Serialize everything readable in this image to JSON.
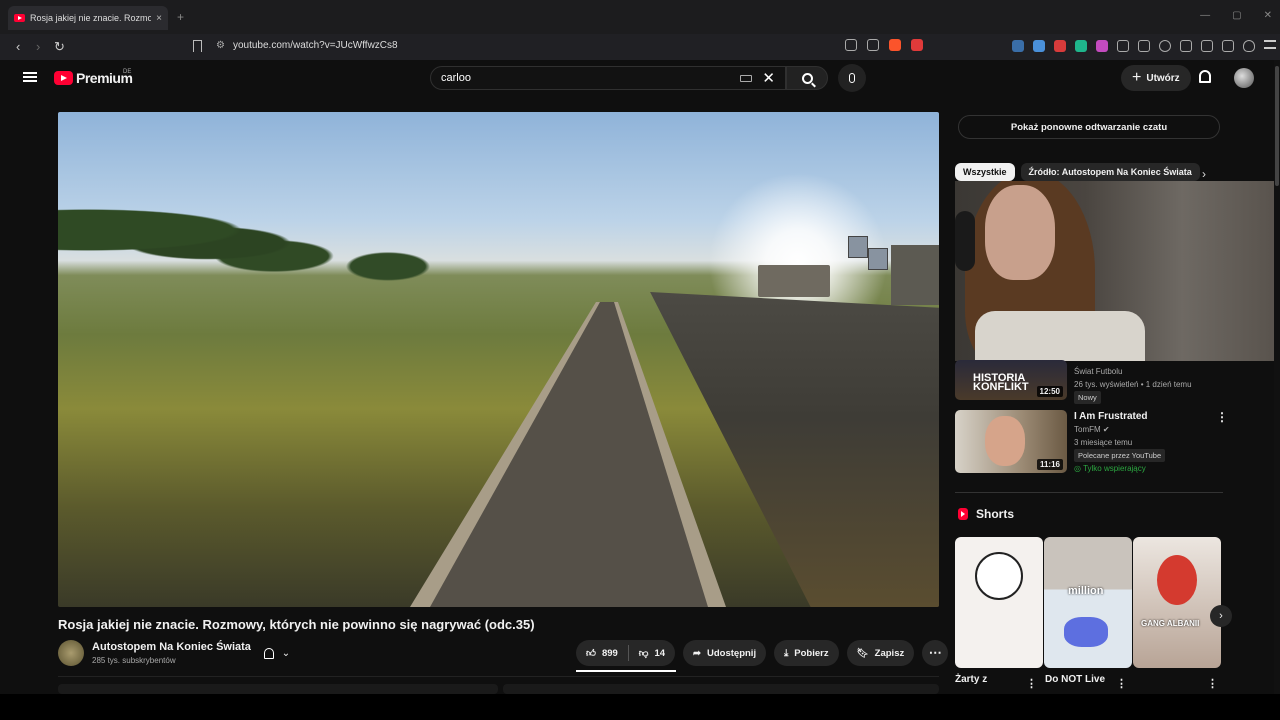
{
  "browser": {
    "tab_title": "Rosja jakiej nie znacie. Rozmo",
    "tab_close": "×",
    "new_tab": "+",
    "url": "youtube.com/watch?v=JUcWffwzCs8",
    "back": "‹",
    "forward": "›",
    "reload": "↻",
    "minimize": "—",
    "maximize": "▢",
    "close": "✕"
  },
  "header": {
    "logo_text": "Premium",
    "logo_sup": "DE",
    "search_value": "carloo",
    "create_label": "Utwórz",
    "create_plus": "+"
  },
  "video": {
    "title": "Rosja jakiej nie znacie. Rozmowy, których nie powinno się nagrywać (odc.35)",
    "channel": "Autostopem Na Koniec Świata",
    "subscribers": "285 tys. subskrybentów",
    "likes": "899",
    "dislikes": "14",
    "share": "Udostępnij",
    "download": "Pobierz",
    "save": "Zapisz",
    "more": "⋯",
    "bell_chevron": "⌄"
  },
  "sidebar": {
    "chat_replay": "Pokaż ponowne odtwarzanie czatu",
    "chips": [
      "Wszystkie",
      "Źródło: Autostopem Na Koniec Świata"
    ],
    "chips_next": "›",
    "recommendations": [
      {
        "title": "",
        "thumb_text": "HISTORIA KONFLIKT",
        "duration": "12:50",
        "channel": "Świat Futbolu",
        "meta": "26 tys. wyświetleń • 1 dzień temu",
        "badge": "Nowy"
      },
      {
        "title": "I Am Frustrated",
        "duration": "11:16",
        "channel": "TomFM",
        "meta": "3 miesiące temu",
        "badge": "Polecane przez YouTube",
        "members": "Tylko wspierający"
      }
    ],
    "kebab": "⋮",
    "shorts_label": "Shorts",
    "shorts": [
      {
        "title": "Żarty z",
        "overlay": ""
      },
      {
        "title": "Do NOT Live",
        "overlay": "million"
      },
      {
        "title": "",
        "overlay": "GANG ALBANII"
      }
    ],
    "shorts_next": "›"
  },
  "colors": {
    "youtube_red": "#ff0033",
    "background": "#0f0f0f",
    "chip_bg": "#272727"
  },
  "icons": [
    "menu-icon",
    "youtube-logo-icon",
    "keyboard-icon",
    "clear-icon",
    "search-icon",
    "mic-icon",
    "plus-icon",
    "bell-icon",
    "like-icon",
    "dislike-icon",
    "share-icon",
    "download-icon",
    "save-icon",
    "shorts-icon"
  ]
}
